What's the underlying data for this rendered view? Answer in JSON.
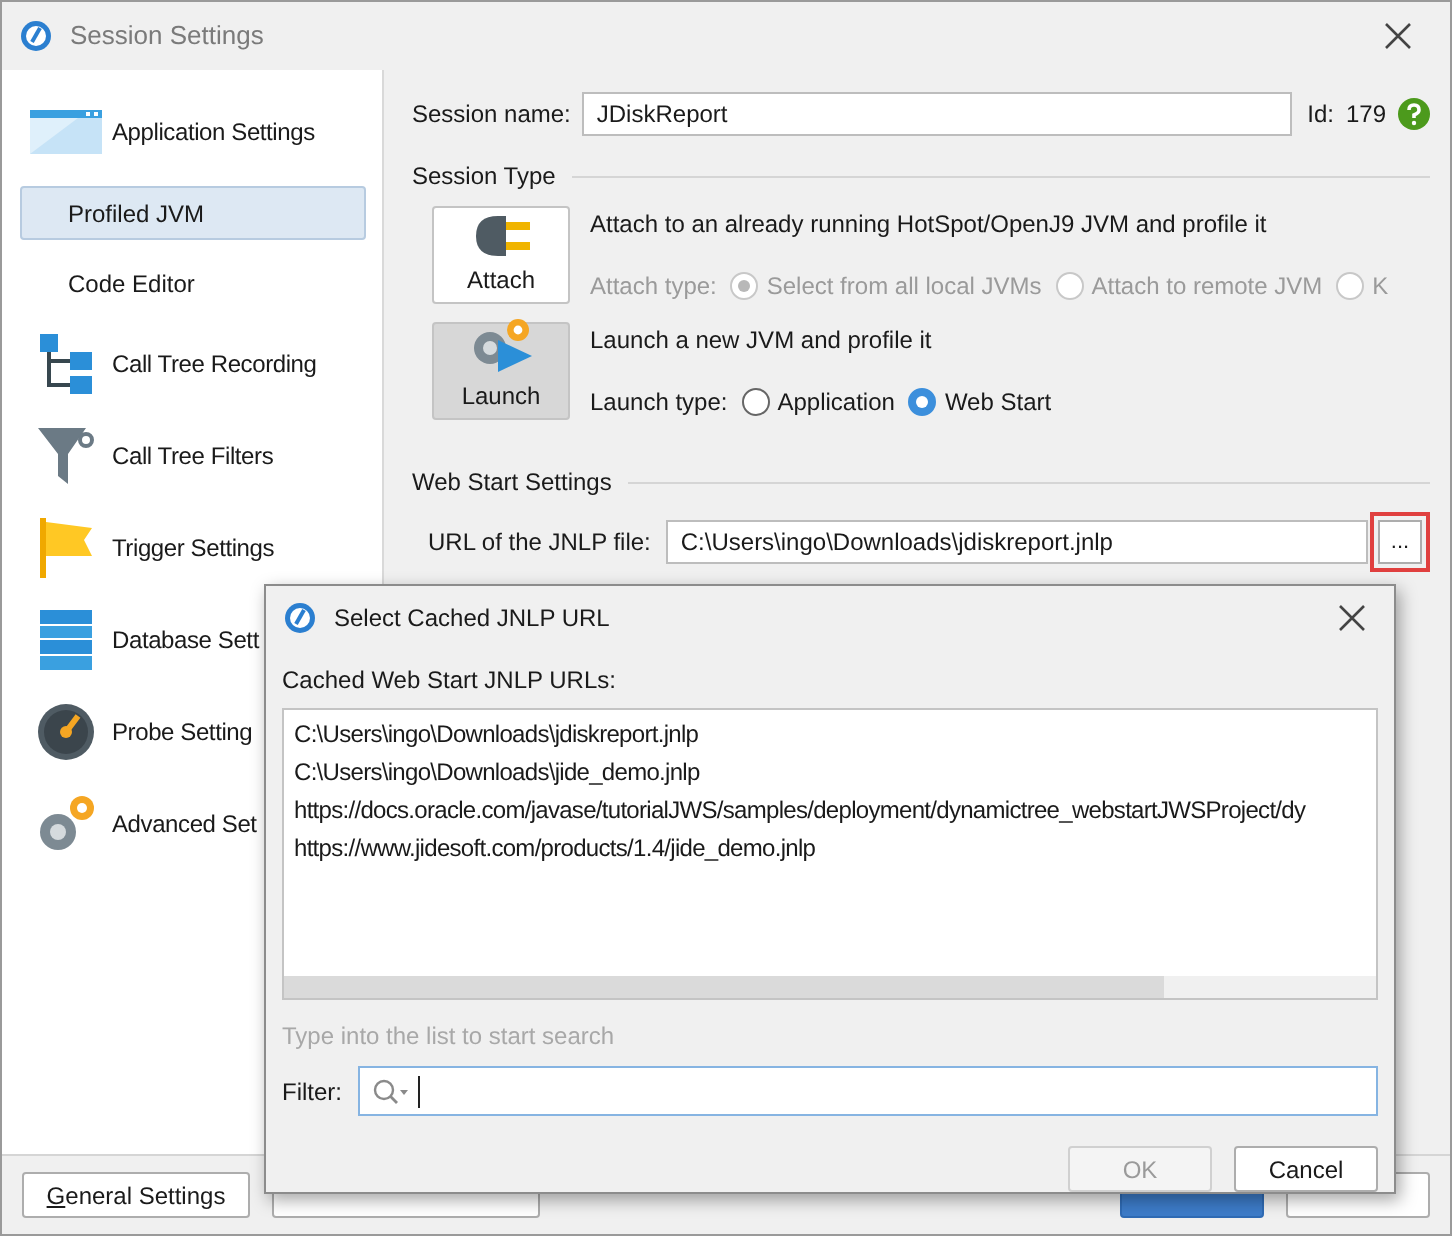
{
  "window": {
    "title": "Session Settings"
  },
  "sidebar": {
    "items": [
      {
        "label": "Application Settings",
        "kind": "section",
        "selected": false
      },
      {
        "label": "Profiled JVM",
        "kind": "sub",
        "selected": true
      },
      {
        "label": "Code Editor",
        "kind": "sub",
        "selected": false
      },
      {
        "label": "Call Tree Recording",
        "kind": "section",
        "selected": false
      },
      {
        "label": "Call Tree Filters",
        "kind": "section",
        "selected": false
      },
      {
        "label": "Trigger Settings",
        "kind": "section",
        "selected": false
      },
      {
        "label": "Database Sett",
        "kind": "section",
        "selected": false
      },
      {
        "label": "Probe Setting",
        "kind": "section",
        "selected": false
      },
      {
        "label": "Advanced Set",
        "kind": "section",
        "selected": false
      }
    ]
  },
  "session_name": {
    "label": "Session name:",
    "value": "JDiskReport",
    "id_label": "Id:",
    "id": "179"
  },
  "session_type": {
    "title": "Session Type",
    "options": [
      {
        "button": "Attach",
        "selected": false,
        "description": "Attach to an already running HotSpot/OpenJ9 JVM and profile it",
        "type_label": "Attach type:",
        "disabled": true,
        "radios": [
          {
            "label": "Select from all local JVMs",
            "selected": true
          },
          {
            "label": "Attach to remote JVM",
            "selected": false
          },
          {
            "label": "K",
            "selected": false
          }
        ]
      },
      {
        "button": "Launch",
        "selected": true,
        "description": "Launch a new JVM and profile it",
        "type_label": "Launch type:",
        "disabled": false,
        "radios": [
          {
            "label": "Application",
            "selected": false
          },
          {
            "label": "Web Start",
            "selected": true
          }
        ]
      }
    ]
  },
  "web_start": {
    "title": "Web Start Settings",
    "url_label": "URL of the JNLP file:",
    "url": "C:\\Users\\ingo\\Downloads\\jdiskreport.jnlp",
    "browse_button": "...",
    "browse_highlighted": true
  },
  "footer": {
    "buttons": [
      {
        "label": "General Settings",
        "mnemonic_underlined": true,
        "kind": "plain"
      },
      {
        "kind": "plain"
      },
      {
        "kind": "primary"
      },
      {
        "kind": "plain"
      }
    ]
  },
  "dialog": {
    "title": "Select Cached JNLP URL",
    "list_label": "Cached Web Start JNLP URLs:",
    "urls": [
      "C:\\Users\\ingo\\Downloads\\jdiskreport.jnlp",
      "C:\\Users\\ingo\\Downloads\\jide_demo.jnlp",
      "https://docs.oracle.com/javase/tutorialJWS/samples/deployment/dynamictree_webstartJWSProject/dy",
      "https://www.jidesoft.com/products/1.4/jide_demo.jnlp"
    ],
    "hint": "Type into the list to start search",
    "filter_label": "Filter:",
    "buttons": [
      {
        "label": "OK",
        "disabled": true
      },
      {
        "label": "Cancel",
        "disabled": false
      }
    ]
  }
}
